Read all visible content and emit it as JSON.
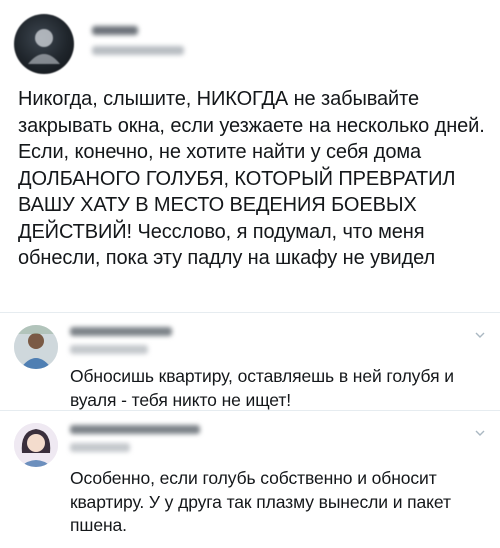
{
  "tweet": {
    "author_name": "Nikita",
    "author_handle": "@kozina_00",
    "text": "Никогда, слышите, НИКОГДА не забывайте закрывать окна, если уезжаете на несколько дней. Если, конечно, не хотите найти у себя дома ДОЛБАНОГО ГОЛУБЯ, КОТОРЫЙ ПРЕВРАТИЛ ВАШУ ХАТУ В МЕСТО ВЕДЕНИЯ БОЕВЫХ ДЕЙСТВИЙ! Чесслово, я подумал, что меня обнесли, пока эту падлу на шкафу не увидел"
  },
  "replies": [
    {
      "text": "Обносишь квартиру, оставляешь в ней голубя и вуаля - тебя никто не ищет!",
      "menu_icon": "chevron-down-icon"
    },
    {
      "text": "Особенно, если голубь собственно и обносит квартиру. У у друга так плазму вынесли и пакет пшена.",
      "menu_icon": "chevron-down-icon"
    }
  ]
}
